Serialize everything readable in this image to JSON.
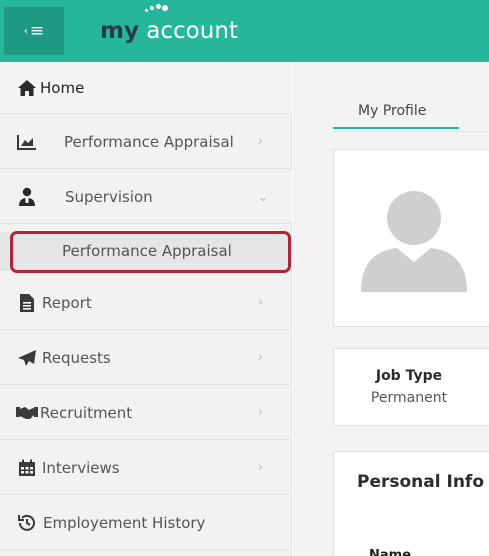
{
  "header": {
    "brand_my": "my",
    "brand_account": "account",
    "menu_icon": "menu-toggle-icon"
  },
  "sidebar": {
    "items": [
      {
        "label": "Home",
        "icon": "home-icon",
        "chevron": ""
      },
      {
        "label": "Performance Appraisal",
        "icon": "chart-icon",
        "chevron": "›"
      },
      {
        "label": "Supervision",
        "icon": "supervisor-icon",
        "chevron": "⌄"
      },
      {
        "label": "Report",
        "icon": "file-icon",
        "chevron": "›"
      },
      {
        "label": "Requests",
        "icon": "paper-plane-icon",
        "chevron": "›"
      },
      {
        "label": "Recruitment",
        "icon": "handshake-icon",
        "chevron": "›"
      },
      {
        "label": "Interviews",
        "icon": "calendar-icon",
        "chevron": "›"
      },
      {
        "label": "Employement History",
        "icon": "history-icon",
        "chevron": ""
      }
    ],
    "sub_item": {
      "label": "Performance Appraisal"
    }
  },
  "main": {
    "tab_label": "My Profile",
    "job_type_title": "Job Type",
    "job_type_value": "Permanent",
    "personal_info_title": "Personal Info",
    "name_label": "Name"
  },
  "colors": {
    "brand": "#26b79a",
    "highlight": "#b32236"
  }
}
